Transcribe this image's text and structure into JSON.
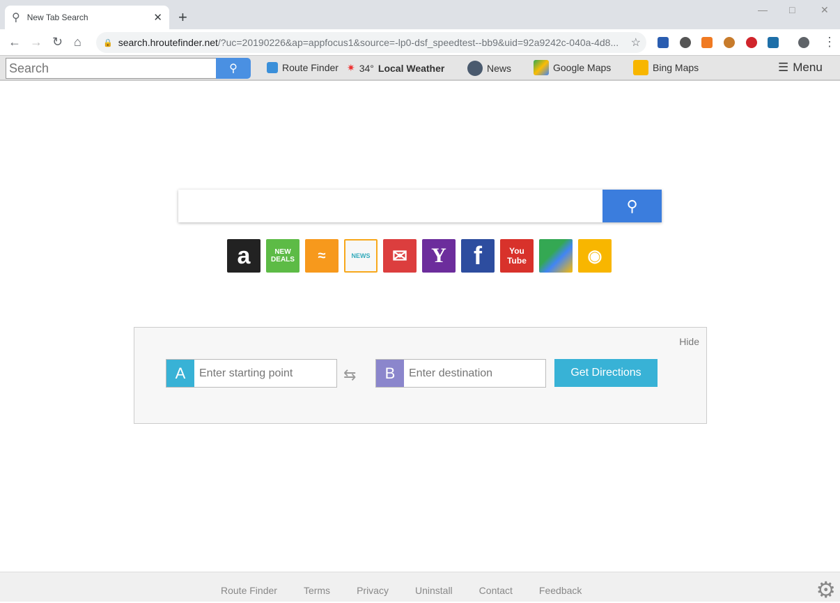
{
  "browser": {
    "tab_title": "New Tab Search",
    "url_host": "search.hroutefinder.net",
    "url_rest": "/?uc=20190226&ap=appfocus1&source=-lp0-dsf_speedtest--bb9&uid=92a9242c-040a-4d8..."
  },
  "extbar": {
    "search_placeholder": "Search",
    "links": [
      "Route Finder",
      "34°",
      "Local Weather",
      "News",
      "Google Maps",
      "Bing Maps"
    ],
    "menu": "Menu"
  },
  "tiles": [
    "Amazon",
    "New Deals",
    "Audible",
    "News",
    "Gmail",
    "Yahoo",
    "Facebook",
    "YouTube",
    "Google Maps",
    "Bing Maps"
  ],
  "directions": {
    "hide": "Hide",
    "a": "A",
    "b": "B",
    "start_placeholder": "Enter starting point",
    "dest_placeholder": "Enter destination",
    "go": "Get Directions"
  },
  "footer": {
    "links": [
      "Route Finder",
      "Terms",
      "Privacy",
      "Uninstall",
      "Contact",
      "Feedback"
    ]
  }
}
